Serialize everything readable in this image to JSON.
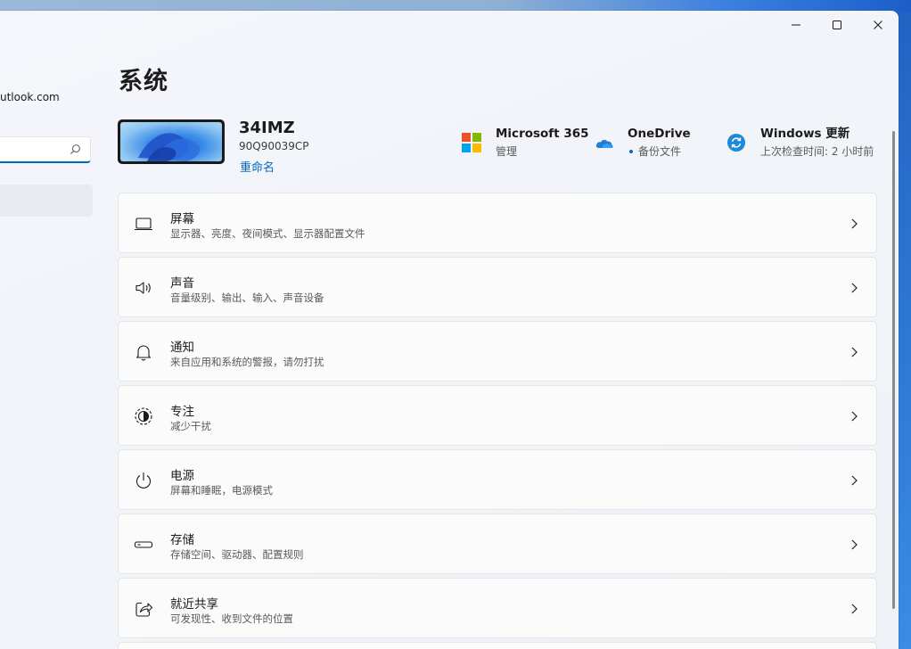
{
  "window": {
    "controls": {
      "minimize": "minimize",
      "maximize": "maximize",
      "close": "close"
    }
  },
  "sidebar": {
    "account_email": "utlook.com",
    "search": {
      "value": "",
      "placeholder": ""
    }
  },
  "header": {
    "title": "系统"
  },
  "device": {
    "name": "34IMZ",
    "model": "90Q90039CP",
    "rename_label": "重命名"
  },
  "quick_status": [
    {
      "title": "Microsoft 365",
      "subtitle": "管理",
      "icon": "microsoft-logo-icon"
    },
    {
      "title": "OneDrive",
      "subtitle": "备份文件",
      "icon": "onedrive-cloud-icon"
    },
    {
      "title": "Windows 更新",
      "subtitle": "上次检查时间: 2 小时前",
      "icon": "windows-update-icon"
    }
  ],
  "settings": [
    {
      "title": "屏幕",
      "subtitle": "显示器、亮度、夜间模式、显示器配置文件",
      "icon": "display-icon"
    },
    {
      "title": "声音",
      "subtitle": "音量级别、输出、输入、声音设备",
      "icon": "speaker-icon"
    },
    {
      "title": "通知",
      "subtitle": "来自应用和系统的警报，请勿打扰",
      "icon": "bell-icon"
    },
    {
      "title": "专注",
      "subtitle": "减少干扰",
      "icon": "focus-icon"
    },
    {
      "title": "电源",
      "subtitle": "屏幕和睡眠，电源模式",
      "icon": "power-icon"
    },
    {
      "title": "存储",
      "subtitle": "存储空间、驱动器、配置规则",
      "icon": "storage-icon"
    },
    {
      "title": "就近共享",
      "subtitle": "可发现性、收到文件的位置",
      "icon": "share-icon"
    }
  ],
  "colors": {
    "accent": "#0067c0",
    "ms_red": "#f25022",
    "ms_green": "#7fba00",
    "ms_blue": "#00a4ef",
    "ms_yellow": "#ffb900"
  }
}
